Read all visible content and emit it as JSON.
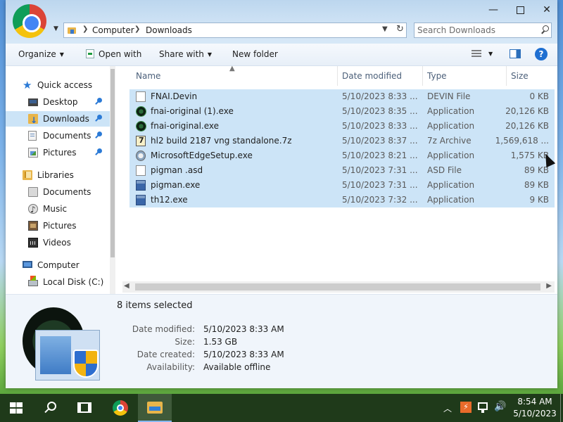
{
  "window": {
    "address": {
      "crumbs": [
        "Computer",
        "Downloads"
      ]
    },
    "search": {
      "placeholder": "Search Downloads"
    }
  },
  "toolbar": {
    "organize": "Organize",
    "open_with": "Open with",
    "share_with": "Share with",
    "new_folder": "New folder"
  },
  "nav": {
    "items": [
      {
        "label": "Quick access",
        "icon": "star-icon"
      },
      {
        "label": "Desktop",
        "icon": "desktop-icon",
        "pinned": true
      },
      {
        "label": "Downloads",
        "icon": "downloads-folder-icon",
        "pinned": true,
        "selected": true
      },
      {
        "label": "Documents",
        "icon": "documents-icon",
        "pinned": true
      },
      {
        "label": "Pictures",
        "icon": "pictures-icon",
        "pinned": true
      },
      {
        "label": "Libraries",
        "icon": "libraries-icon"
      },
      {
        "label": "Documents",
        "icon": "documents-library-icon"
      },
      {
        "label": "Music",
        "icon": "music-icon"
      },
      {
        "label": "Pictures",
        "icon": "pictures-library-icon"
      },
      {
        "label": "Videos",
        "icon": "videos-icon"
      },
      {
        "label": "Computer",
        "icon": "computer-icon"
      },
      {
        "label": "Local Disk (C:)",
        "icon": "local-disk-icon"
      }
    ]
  },
  "columns": {
    "name": "Name",
    "date_modified": "Date modified",
    "type": "Type",
    "size": "Size"
  },
  "files": [
    {
      "name": "FNAI.Devin",
      "date": "5/10/2023 8:33 ...",
      "type": "DEVIN File",
      "size": "0 KB",
      "icon": "blank-file-icon"
    },
    {
      "name": "fnai-original (1).exe",
      "date": "5/10/2023 8:35 ...",
      "type": "Application",
      "size": "20,126 KB",
      "icon": "fnai-app-icon"
    },
    {
      "name": "fnai-original.exe",
      "date": "5/10/2023 8:33 ...",
      "type": "Application",
      "size": "20,126 KB",
      "icon": "fnai-app-icon"
    },
    {
      "name": "hl2 build 2187 vng standalone.7z",
      "date": "5/10/2023 8:37 ...",
      "type": "7z Archive",
      "size": "1,569,618 ...",
      "icon": "7z-archive-icon"
    },
    {
      "name": "MicrosoftEdgeSetup.exe",
      "date": "5/10/2023 8:21 ...",
      "type": "Application",
      "size": "1,575 KB",
      "icon": "edge-setup-icon"
    },
    {
      "name": "pigman .asd",
      "date": "5/10/2023 7:31 ...",
      "type": "ASD File",
      "size": "89 KB",
      "icon": "blank-file-icon"
    },
    {
      "name": "pigman.exe",
      "date": "5/10/2023 7:31 ...",
      "type": "Application",
      "size": "89 KB",
      "icon": "exe-icon"
    },
    {
      "name": "th12.exe",
      "date": "5/10/2023 7:32 ...",
      "type": "Application",
      "size": "9 KB",
      "icon": "exe-icon"
    }
  ],
  "details": {
    "selection_count": "8 items selected",
    "fields": [
      {
        "label": "Date modified:",
        "value": "5/10/2023 8:33 AM"
      },
      {
        "label": "Size:",
        "value": "1.53 GB"
      },
      {
        "label": "Date created:",
        "value": "5/10/2023 8:33 AM"
      },
      {
        "label": "Availability:",
        "value": "Available offline"
      }
    ]
  },
  "taskbar": {
    "time": "8:54 AM",
    "date": "5/10/2023"
  },
  "colors": {
    "selection": "#cce4f7",
    "accent": "#1f6fd1",
    "taskbar": "#1f3a1a"
  }
}
